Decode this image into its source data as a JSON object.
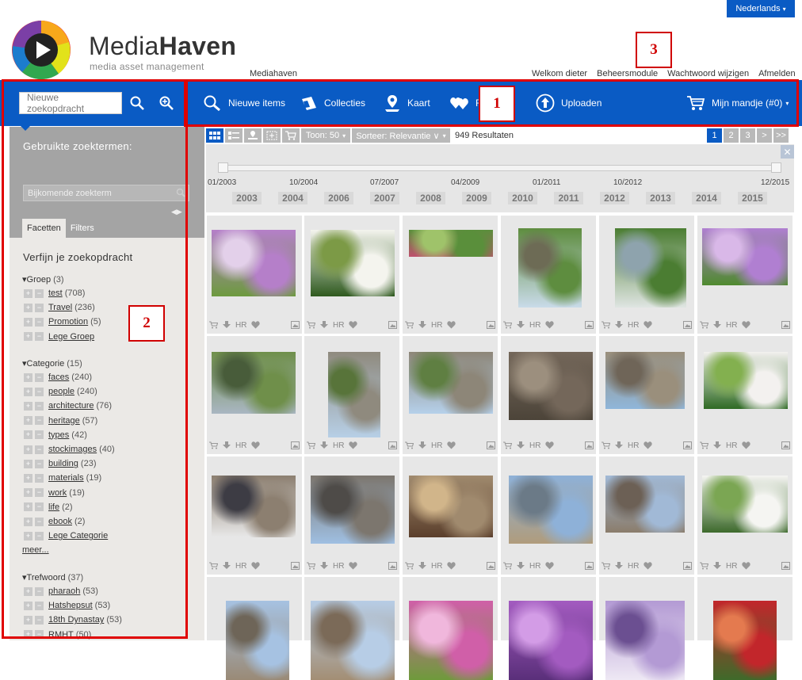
{
  "header": {
    "language": "Nederlands",
    "brand_light": "Media",
    "brand_bold": "Haven",
    "tagline": "media asset management",
    "breadcrumb": "Mediahaven",
    "links": [
      "Welkom dieter",
      "Beheersmodule",
      "Wachtwoord wijzigen",
      "Afmelden"
    ]
  },
  "nav": {
    "search_placeholder": "Nieuwe zoekopdracht",
    "items": [
      "Nieuwe items",
      "Collecties",
      "Kaart",
      "Fa",
      "Uploaden"
    ],
    "basket": "Mijn mandje (#0)"
  },
  "sidebar": {
    "used_terms": "Gebruikte zoektermen:",
    "add_term_placeholder": "Bijkomende zoekterm",
    "tabs": [
      "Facetten",
      "Filters"
    ],
    "refine_title": "Verfijn je zoekopdracht",
    "groups": [
      {
        "title": "Groep",
        "count": "(3)",
        "items": [
          {
            "label": "test",
            "count": "(708)"
          },
          {
            "label": "Travel",
            "count": "(236)"
          },
          {
            "label": "Promotion",
            "count": "(5)"
          },
          {
            "label": "Lege Groep",
            "count": ""
          }
        ]
      },
      {
        "title": "Categorie",
        "count": "(15)",
        "items": [
          {
            "label": "faces",
            "count": "(240)"
          },
          {
            "label": "people",
            "count": "(240)"
          },
          {
            "label": "architecture",
            "count": "(76)"
          },
          {
            "label": "heritage",
            "count": "(57)"
          },
          {
            "label": "types",
            "count": "(42)"
          },
          {
            "label": "stockimages",
            "count": "(40)"
          },
          {
            "label": "building",
            "count": "(23)"
          },
          {
            "label": "materials",
            "count": "(19)"
          },
          {
            "label": "work",
            "count": "(19)"
          },
          {
            "label": "life",
            "count": "(2)"
          },
          {
            "label": "ebook",
            "count": "(2)"
          },
          {
            "label": "Lege Categorie",
            "count": ""
          }
        ],
        "more": "meer..."
      },
      {
        "title": "Trefwoord",
        "count": "(37)",
        "items": [
          {
            "label": "pharaoh",
            "count": "(53)"
          },
          {
            "label": "Hatshepsut",
            "count": "(53)"
          },
          {
            "label": "18th Dynastay",
            "count": "(53)"
          },
          {
            "label": "RMHT",
            "count": "(50)"
          }
        ]
      }
    ]
  },
  "toolbar": {
    "show": "Toon: 50",
    "sort": "Sorteer: Relevantie ∨",
    "results": "949 Resultaten",
    "pages": [
      "1",
      "2",
      "3",
      ">",
      ">>"
    ]
  },
  "timeline": {
    "dates": [
      "01/2003",
      "10/2004",
      "07/2007",
      "04/2009",
      "01/2011",
      "10/2012",
      "12/2015"
    ],
    "years": [
      "2003",
      "2004",
      "2006",
      "2007",
      "2008",
      "2009",
      "2010",
      "2011",
      "2012",
      "2013",
      "2014",
      "2015"
    ]
  },
  "grid": {
    "action_hr": "HR",
    "thumbs": [
      {
        "name": "purple-flowers",
        "colors": [
          "#b57fc9",
          "#6d9a3f",
          "#e3d0ea"
        ]
      },
      {
        "name": "white-lilies",
        "colors": [
          "#f4f4ee",
          "#2f5a1f",
          "#7c9a46"
        ]
      },
      {
        "name": "garden-hedge",
        "colors": [
          "#5a8f3b",
          "#c0506e",
          "#9fc36a"
        ]
      },
      {
        "name": "canal-trees",
        "colors": [
          "#5e8d3f",
          "#c9dbe9",
          "#6d6b55"
        ]
      },
      {
        "name": "river-rapids",
        "colors": [
          "#4b7d32",
          "#dfe5e2",
          "#8ea3ad"
        ]
      },
      {
        "name": "chive-flowers",
        "colors": [
          "#b07fd1",
          "#4f8a2f",
          "#d9b8e8"
        ]
      },
      {
        "name": "river-willows",
        "colors": [
          "#6f8f4a",
          "#a9b6c2",
          "#485c3a"
        ]
      },
      {
        "name": "castle-statue",
        "colors": [
          "#8f8a7e",
          "#b7cfe6",
          "#58743a"
        ]
      },
      {
        "name": "stone-castle",
        "colors": [
          "#8d8678",
          "#b5d0ea",
          "#5f7f42"
        ]
      },
      {
        "name": "gothic-windows",
        "colors": [
          "#74675a",
          "#4c4439",
          "#9c8f7e"
        ]
      },
      {
        "name": "church-tower",
        "colors": [
          "#9a8f7c",
          "#8fb6da",
          "#6f6558"
        ]
      },
      {
        "name": "bleeding-hearts",
        "colors": [
          "#f3f1ef",
          "#2f6a24",
          "#83b04f"
        ]
      },
      {
        "name": "cathedral-bus",
        "colors": [
          "#8c7f70",
          "#e8e8e8",
          "#3d3c44"
        ]
      },
      {
        "name": "guild-hall",
        "colors": [
          "#7c766e",
          "#9fbfe2",
          "#4e4b48"
        ]
      },
      {
        "name": "horse-carriage",
        "colors": [
          "#a08a6e",
          "#5b3f2c",
          "#d1b58a"
        ]
      },
      {
        "name": "canal-boat",
        "colors": [
          "#8eb1d8",
          "#b09c7c",
          "#6b7a87"
        ]
      },
      {
        "name": "belfry-square",
        "colors": [
          "#a1b9d6",
          "#8b7d6c",
          "#6c6055"
        ]
      },
      {
        "name": "white-hydrangea",
        "colors": [
          "#f5f5f2",
          "#3d6a2c",
          "#7ba653"
        ]
      },
      {
        "name": "gable-houses",
        "colors": [
          "#a6c2e2",
          "#9a8a76",
          "#6e6558"
        ]
      },
      {
        "name": "old-facades",
        "colors": [
          "#b7cde6",
          "#a38e74",
          "#7b6a58"
        ]
      },
      {
        "name": "pink-blossoms",
        "colors": [
          "#d05fa8",
          "#6f9a3b",
          "#f0b7dc"
        ]
      },
      {
        "name": "violet-flowers",
        "colors": [
          "#a35bc0",
          "#5a2f7a",
          "#d39ce6"
        ]
      },
      {
        "name": "lilac-clusters",
        "colors": [
          "#b39ad4",
          "#eee8f4",
          "#6b4f91"
        ]
      },
      {
        "name": "red-lilies",
        "colors": [
          "#c2262b",
          "#3f6a2a",
          "#e47a4f"
        ]
      }
    ]
  },
  "annotations": [
    "1",
    "2",
    "3"
  ],
  "colors": {
    "brand_blue": "#0a5bc4",
    "annotation_red": "#e00000"
  }
}
